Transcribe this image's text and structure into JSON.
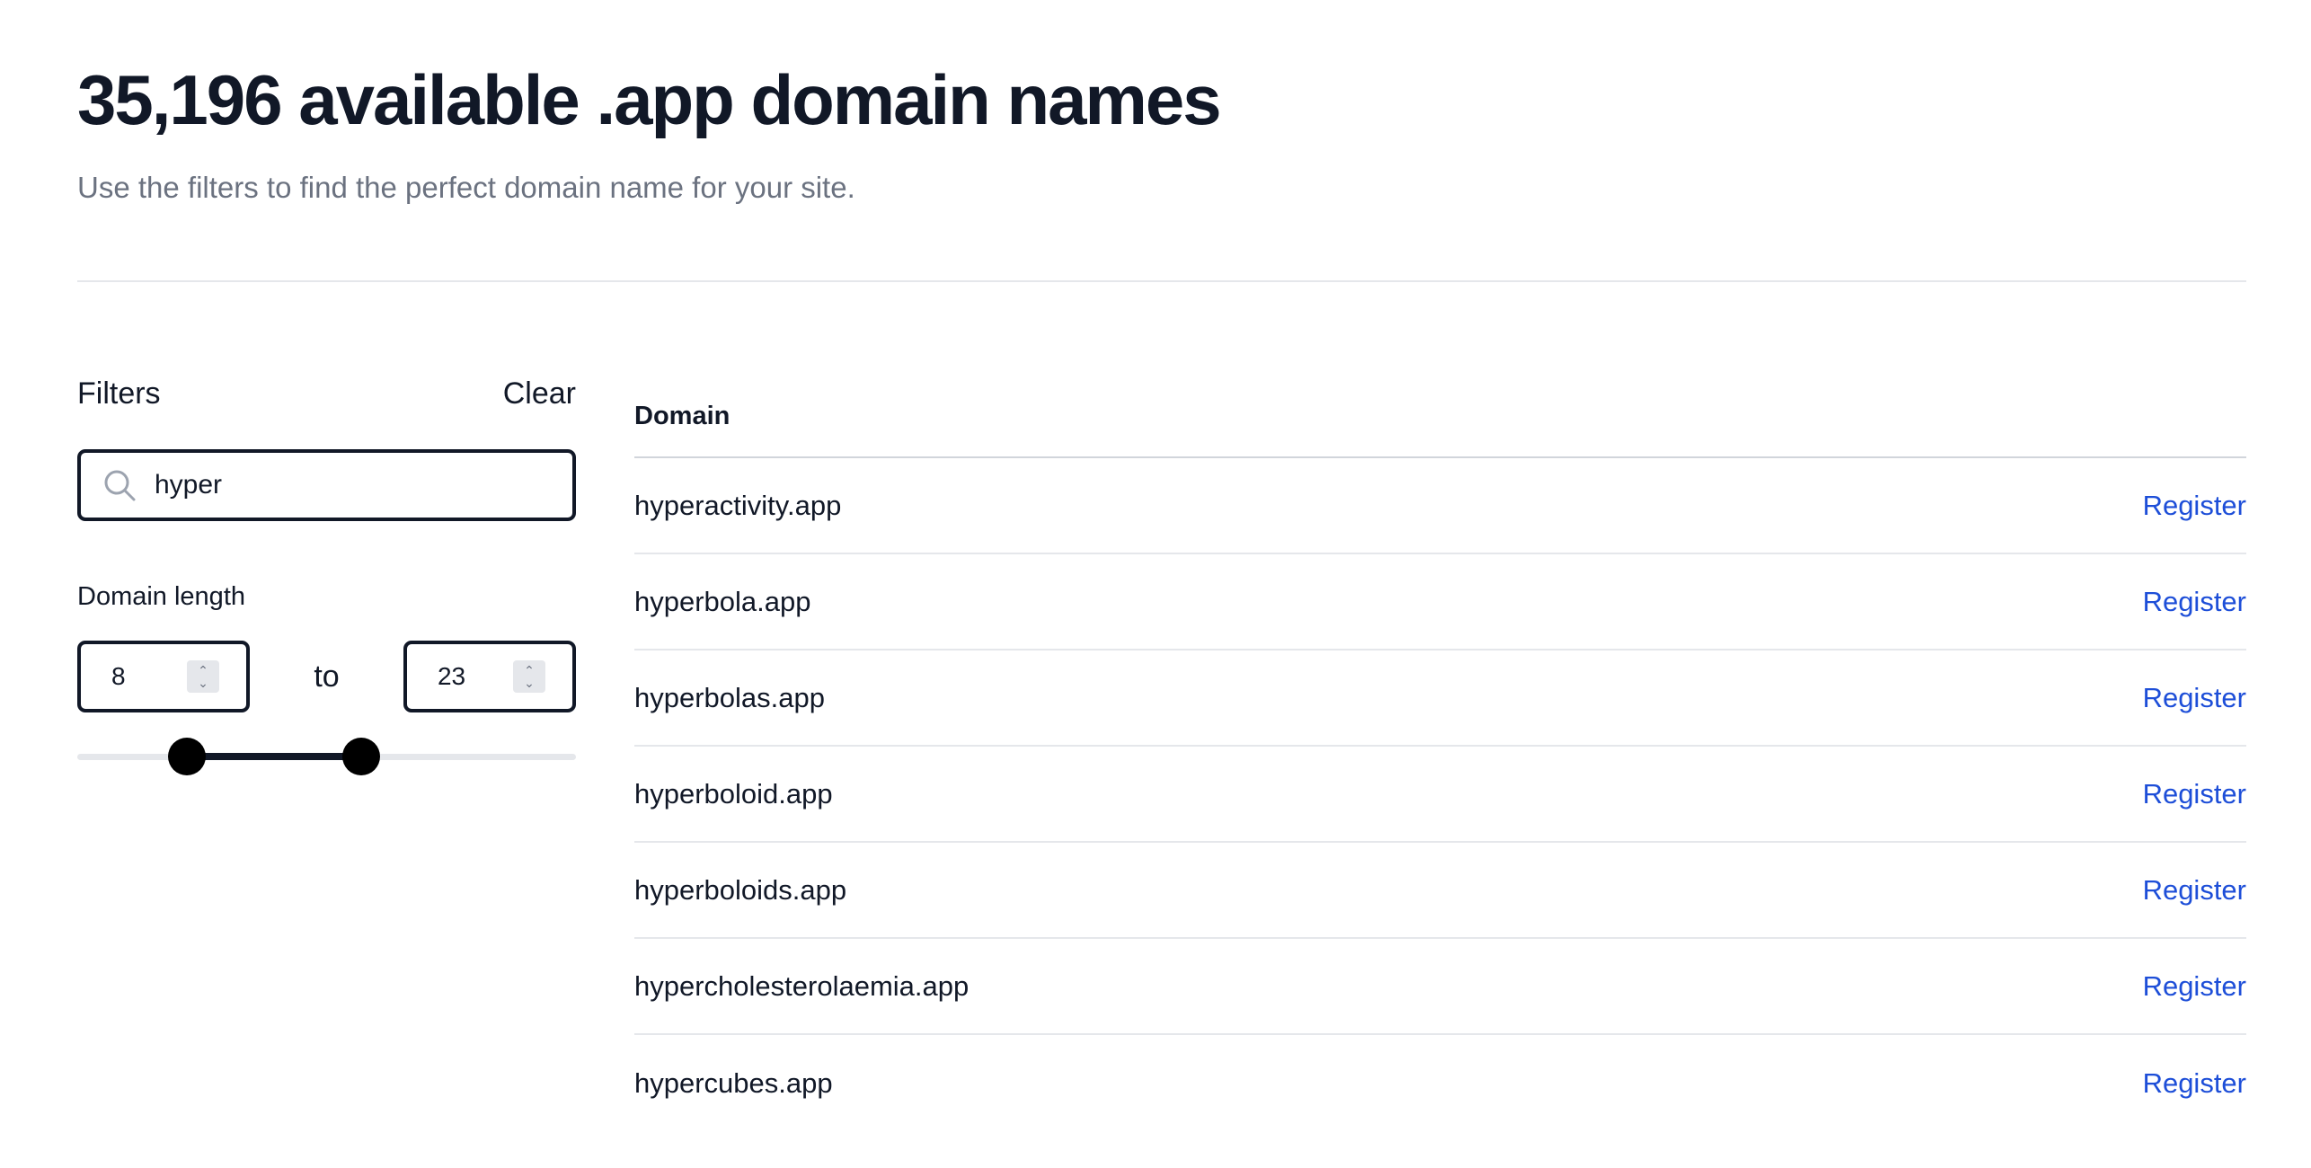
{
  "header": {
    "title": "35,196 available .app domain names",
    "subtitle": "Use the filters to find the perfect domain name for your site."
  },
  "filters": {
    "title": "Filters",
    "clear_label": "Clear",
    "search_value": "hyper",
    "search_icon": "search-icon",
    "length_label": "Domain length",
    "min_length": "8",
    "max_length": "23",
    "to_label": "to",
    "slider": {
      "min_fraction": 0.22,
      "max_fraction": 0.57
    }
  },
  "table": {
    "column_header": "Domain",
    "rows": [
      {
        "domain": "hyperactivity.app",
        "action": "Register"
      },
      {
        "domain": "hyperbola.app",
        "action": "Register"
      },
      {
        "domain": "hyperbolas.app",
        "action": "Register"
      },
      {
        "domain": "hyperboloid.app",
        "action": "Register"
      },
      {
        "domain": "hyperboloids.app",
        "action": "Register"
      },
      {
        "domain": "hypercholesterolaemia.app",
        "action": "Register"
      },
      {
        "domain": "hypercubes.app",
        "action": "Register"
      }
    ]
  },
  "colors": {
    "link": "#1d4ed8",
    "text": "#111827",
    "muted": "#6b7280",
    "border": "#e5e7eb"
  }
}
